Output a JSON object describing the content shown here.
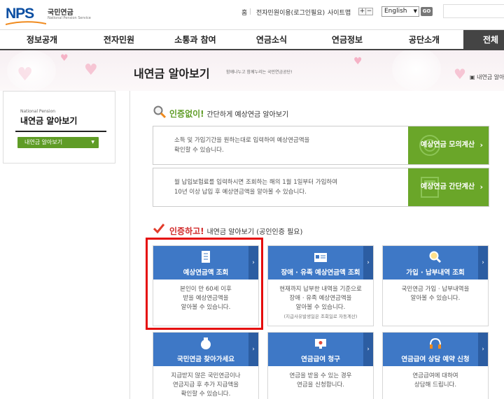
{
  "logo": {
    "mark": "NPS",
    "kr": "국민연금",
    "en": "National Pension Service"
  },
  "util": {
    "home": "홈",
    "login": "전자민원이용(로그인필요)",
    "sitemap": "사이트맵",
    "zoom_in": "+",
    "zoom_out": "−",
    "language": "English",
    "go": "GO"
  },
  "gnb": [
    "정보공개",
    "전자민원",
    "소통과 참여",
    "연금소식",
    "연금정보",
    "공단소개",
    "전체메"
  ],
  "page": {
    "title": "내연금 알아보기",
    "subtitle": "함께나누고 함께누리는 국민연금공단!",
    "breadcrumb": "내연금 알아"
  },
  "lnb": {
    "eng": "National Pension",
    "title": "내연금 알아보기",
    "button": "내연금 알아보기"
  },
  "section1": {
    "em": "인증없이!",
    "rest": "간단하게 예상연금 알아보기"
  },
  "calc": [
    {
      "text_line1": "소득 및 가입기간을 원하는대로 입력하여 예상연금액을",
      "text_line2": "확인할 수 있습니다.",
      "button": "예상연금 모의계산"
    },
    {
      "text_line1": "월 납입보험료를 입력하시면 조회하는 해의 1월 1일부터 가입하여",
      "text_line2": "10년 이상 납입 후 예상연금액을 알아볼 수 있습니다.",
      "button": "예상연금 간단계산"
    }
  ],
  "section2": {
    "em": "인증하고!",
    "rest": "내연금 알아보기 (공인인증 필요)"
  },
  "cards": [
    {
      "title": "예상연금액 조회",
      "lines": [
        "본인이 만 60세 이후",
        "받을 예상연금액을",
        "알아볼 수 있습니다."
      ],
      "note": ""
    },
    {
      "title": "장애 · 유족 예상연금액 조회",
      "lines": [
        "현재까지 납부한 내역을 기준으로",
        "장애 · 유족 예상연금액을",
        "알아볼 수 있습니다."
      ],
      "note": "(지급사유발생일은 조회일로 자동계산)"
    },
    {
      "title": "가입 · 납부내역 조회",
      "lines": [
        "국민연금 가입 · 납부내역을",
        "알아볼 수 있습니다."
      ],
      "note": ""
    },
    {
      "title": "국민연금 찾아가세요",
      "lines": [
        "지급받지 않은 국민연금이나",
        "연금지급 후 추가 지급액을",
        "확인할 수 있습니다."
      ],
      "note": ""
    },
    {
      "title": "연금급여 청구",
      "lines": [
        "연금을 받을 수 있는 경우",
        "연금을 신청합니다."
      ],
      "note": ""
    },
    {
      "title": "연금급여 상담 예약 신청",
      "lines": [
        "연금급여에 대하여",
        "상담해 드립니다."
      ],
      "note": ""
    }
  ],
  "colors": {
    "brand_blue": "#0b4ea2",
    "green": "#6aa629",
    "card_blue": "#3e78c6",
    "highlight_red": "#e50d0d"
  }
}
